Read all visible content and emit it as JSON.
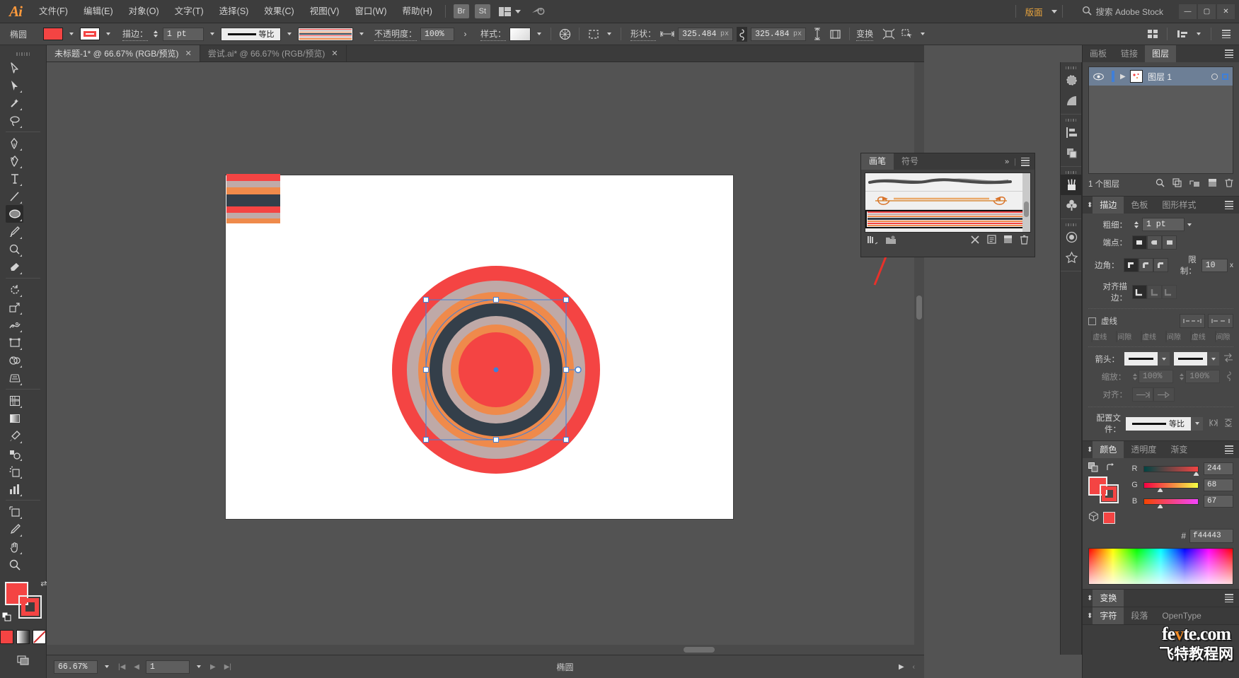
{
  "app": {
    "name": "Adobe Illustrator",
    "logo": "Ai"
  },
  "menubar": {
    "items": [
      "文件(F)",
      "编辑(E)",
      "对象(O)",
      "文字(T)",
      "选择(S)",
      "效果(C)",
      "视图(V)",
      "窗口(W)",
      "帮助(H)"
    ],
    "bridge_label": "Br",
    "stock_label": "St",
    "workspace_label": "版面",
    "search_placeholder": "搜索 Adobe Stock",
    "window_buttons": {
      "minimize": "—",
      "maximize": "▢",
      "close": "✕"
    }
  },
  "controlbar": {
    "object_label": "椭圆",
    "fill_color": "#f44443",
    "stroke_color": "#f44443",
    "stroke_label": "描边：",
    "stroke_weight": "1 pt",
    "profile_label": "等比",
    "opacity_label": "不透明度：",
    "opacity_value": "100%",
    "style_label": "样式：",
    "shape_label": "形状：",
    "width_value": "325.484",
    "width_unit": "px",
    "height_value": "325.484",
    "height_unit": "px",
    "transform_label": "变换"
  },
  "tabs": [
    {
      "title": "未标题-1* @ 66.67% (RGB/预览)",
      "active": true,
      "close": "✕"
    },
    {
      "title": "尝试.ai* @ 66.67% (RGB/预览)",
      "active": false,
      "close": "✕"
    }
  ],
  "toolbar": {
    "selected_tool": "ellipse-tool",
    "tools": [
      "selection-tool",
      "direct-selection-tool",
      "magic-wand-tool",
      "lasso-tool",
      "pen-tool",
      "curvature-tool",
      "type-tool",
      "line-segment-tool",
      "ellipse-tool",
      "paintbrush-tool",
      "shaper-tool",
      "eraser-tool",
      "rotate-tool",
      "scale-tool",
      "width-tool",
      "free-transform-tool",
      "shape-builder-tool",
      "perspective-grid-tool",
      "mesh-tool",
      "gradient-tool",
      "eyedropper-tool",
      "blend-tool",
      "symbol-sprayer-tool",
      "column-graph-tool",
      "artboard-tool",
      "slice-tool",
      "hand-tool",
      "zoom-tool"
    ],
    "fill_color": "#f44443",
    "stroke_color": "#f44443"
  },
  "canvas": {
    "artboard_background": "#ffffff",
    "stripe_swatch": [
      "#f44443",
      "#c0aaa8",
      "#ef8a4b",
      "#343f4a",
      "#f44443",
      "#c0aaa8",
      "#ef8a4b"
    ],
    "rings": [
      {
        "name": "ring-outer-red",
        "color": "#f44443",
        "radius_pct": 100
      },
      {
        "name": "ring-gray",
        "color": "#bfa9a7",
        "radius_pct": 86
      },
      {
        "name": "ring-orange",
        "color": "#ef8a4b",
        "radius_pct": 75
      },
      {
        "name": "ring-navy",
        "color": "#343f4a",
        "radius_pct": 64
      },
      {
        "name": "ring-gray-inner",
        "color": "#bfa9a7",
        "radius_pct": 52
      },
      {
        "name": "ring-orange-inner",
        "color": "#ef8a4b",
        "radius_pct": 44
      },
      {
        "name": "ring-core-red",
        "color": "#f44443",
        "radius_pct": 36
      }
    ],
    "selection_color": "#3f7fd8"
  },
  "brush_panel": {
    "tabs": [
      {
        "label": "画笔",
        "active": true
      },
      {
        "label": "符号",
        "active": false
      }
    ],
    "collapse": "»",
    "items": [
      {
        "name": "charcoal-brush",
        "type": "stroke"
      },
      {
        "name": "arrow-brush",
        "type": "arrow"
      },
      {
        "name": "striped-pattern-brush",
        "type": "pattern",
        "selected": true,
        "colors": [
          "#f44443",
          "#c0aaa8",
          "#ef8a4b",
          "#343f4a",
          "#ef8a4b",
          "#f44443",
          "#c0aaa8"
        ]
      }
    ],
    "footer_icons": [
      "brush-libraries-icon",
      "libraries-icon",
      "remove-brush-stroke-icon",
      "options-icon",
      "new-brush-icon",
      "delete-brush-icon"
    ]
  },
  "dock_mini": {
    "groups": [
      [
        "brushes-icon",
        "symbols-icon"
      ],
      [
        "align-icon",
        "pathfinder-icon"
      ],
      [
        "brushes-panel-icon",
        "symbols-panel-icon"
      ],
      [
        "appearance-icon",
        "graphic-styles-icon"
      ]
    ]
  },
  "layers_panel": {
    "tabs": [
      {
        "label": "画板",
        "active": false
      },
      {
        "label": "链接",
        "active": false
      },
      {
        "label": "图层",
        "active": true
      }
    ],
    "rows": [
      {
        "name": "图层 1",
        "visible": true,
        "selected": true
      }
    ],
    "footer_count": "1 个图层",
    "footer_icons": [
      "locate-object-icon",
      "make-sublayer-icon",
      "release-icon",
      "new-layer-icon",
      "delete-layer-icon"
    ]
  },
  "stroke_panel": {
    "tabs": [
      {
        "label": "描边",
        "active": true
      },
      {
        "label": "色板",
        "active": false
      },
      {
        "label": "图形样式",
        "active": false
      }
    ],
    "weight_label": "粗细：",
    "weight_value": "1 pt",
    "cap_label": "端点：",
    "corner_label": "边角：",
    "limit_label": "限制：",
    "limit_value": "10",
    "limit_unit": "x",
    "align_label": "对齐描边：",
    "dashed_label": "虚线",
    "dash_cells": [
      "虚线",
      "间隙",
      "虚线",
      "间隙",
      "虚线",
      "间隙"
    ],
    "arrow_label": "箭头：",
    "scale_label": "缩放：",
    "scale_value_1": "100%",
    "scale_value_2": "100%",
    "align_arrow_label": "对齐：",
    "profile_label": "配置文件：",
    "profile_value": "等比"
  },
  "color_panel": {
    "tabs": [
      {
        "label": "颜色",
        "active": true
      },
      {
        "label": "透明度",
        "active": false
      },
      {
        "label": "渐变",
        "active": false
      }
    ],
    "channels": [
      {
        "name": "R",
        "value": "244"
      },
      {
        "name": "G",
        "value": "68"
      },
      {
        "name": "B",
        "value": "67"
      }
    ],
    "hex_symbol": "#",
    "hex_value": "f44443",
    "fill_color": "#f44443",
    "stroke_color": "#f44443"
  },
  "bottom_panels": {
    "transform": {
      "label": "变换"
    },
    "character": [
      {
        "label": "字符",
        "active": true
      },
      {
        "label": "段落",
        "active": false
      },
      {
        "label": "OpenType",
        "active": false
      }
    ]
  },
  "statusbar": {
    "zoom": "66.67%",
    "page": "1",
    "tool_name": "椭圆",
    "nav_first": "|◀",
    "nav_prev": "◀",
    "nav_next": "▶",
    "nav_last": "▶|"
  },
  "watermark": {
    "line1_a": "fe",
    "line1_b": "v",
    "line1_c": "te.com",
    "line2": "飞特教程网"
  }
}
